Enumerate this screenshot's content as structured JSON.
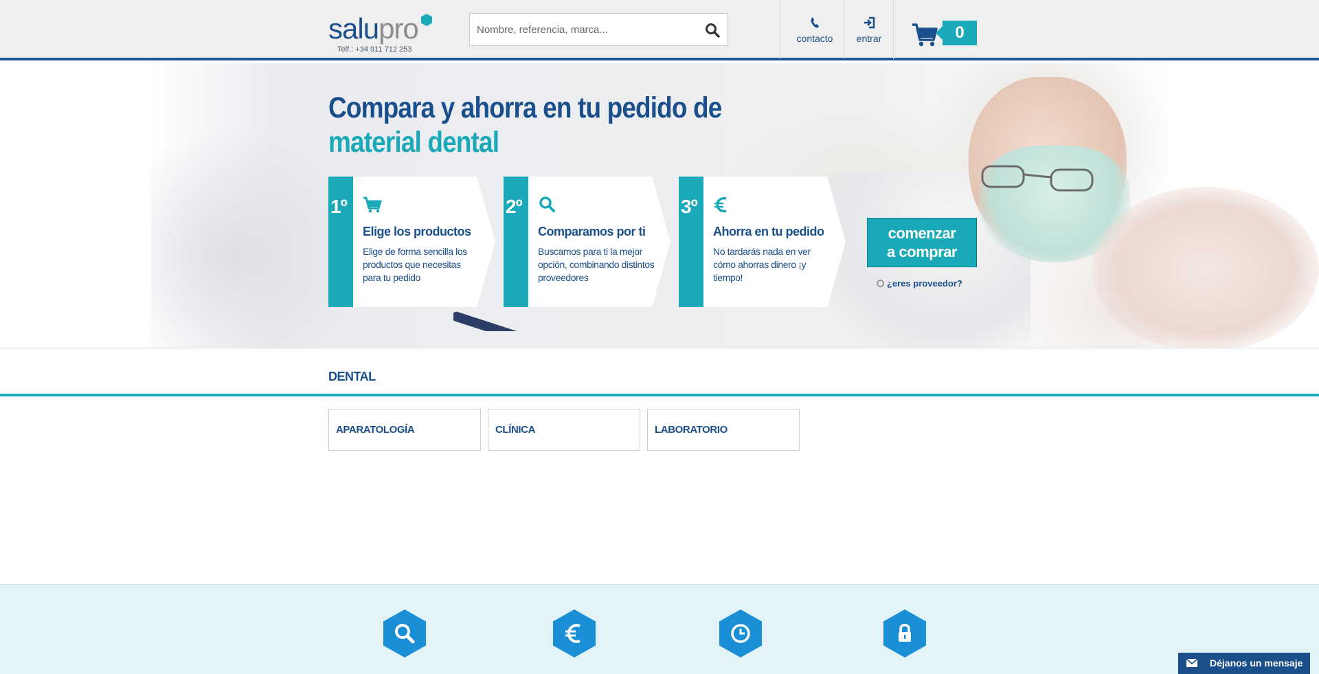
{
  "header": {
    "logo_part1": "salu",
    "logo_part2": "pro",
    "phone": "Telf.: +34 911 712 253",
    "search_placeholder": "Nombre, referencia, marca...",
    "nav_contact": "contacto",
    "nav_login": "entrar",
    "cart_count": "0"
  },
  "hero": {
    "title_line1": "Compara y ahorra en tu pedido de",
    "title_line2": "material dental",
    "steps": [
      {
        "num": "1º",
        "icon": "cart-icon",
        "heading": "Elige los productos",
        "text": "Elige de forma sencilla los productos que necesitas para tu pedido"
      },
      {
        "num": "2º",
        "icon": "search-icon",
        "heading": "Comparamos por ti",
        "text": "Buscamos para ti la mejor opción, combinando distintos proveedores"
      },
      {
        "num": "3º",
        "icon": "euro-icon",
        "heading": "Ahorra en tu pedido",
        "text": "No tardarás nada en ver cómo ahorras dinero ¡y tiempo!"
      }
    ],
    "cta_line1": "comenzar",
    "cta_line2": "a comprar",
    "provider_link": "¿eres proveedor?"
  },
  "dental": {
    "title": "DENTAL",
    "categories": [
      "APARATOLOGÍA",
      "CLÍNICA",
      "LABORATORIO"
    ]
  },
  "features": {
    "icons": [
      "search-icon",
      "euro-icon",
      "clock-icon",
      "lock-icon"
    ]
  },
  "chat": {
    "label": "Déjanos un mensaje"
  },
  "colors": {
    "primary": "#1b4f8c",
    "accent": "#1aa9b9",
    "header_bg": "#efefef",
    "feature_bg": "#e3f4f9"
  }
}
